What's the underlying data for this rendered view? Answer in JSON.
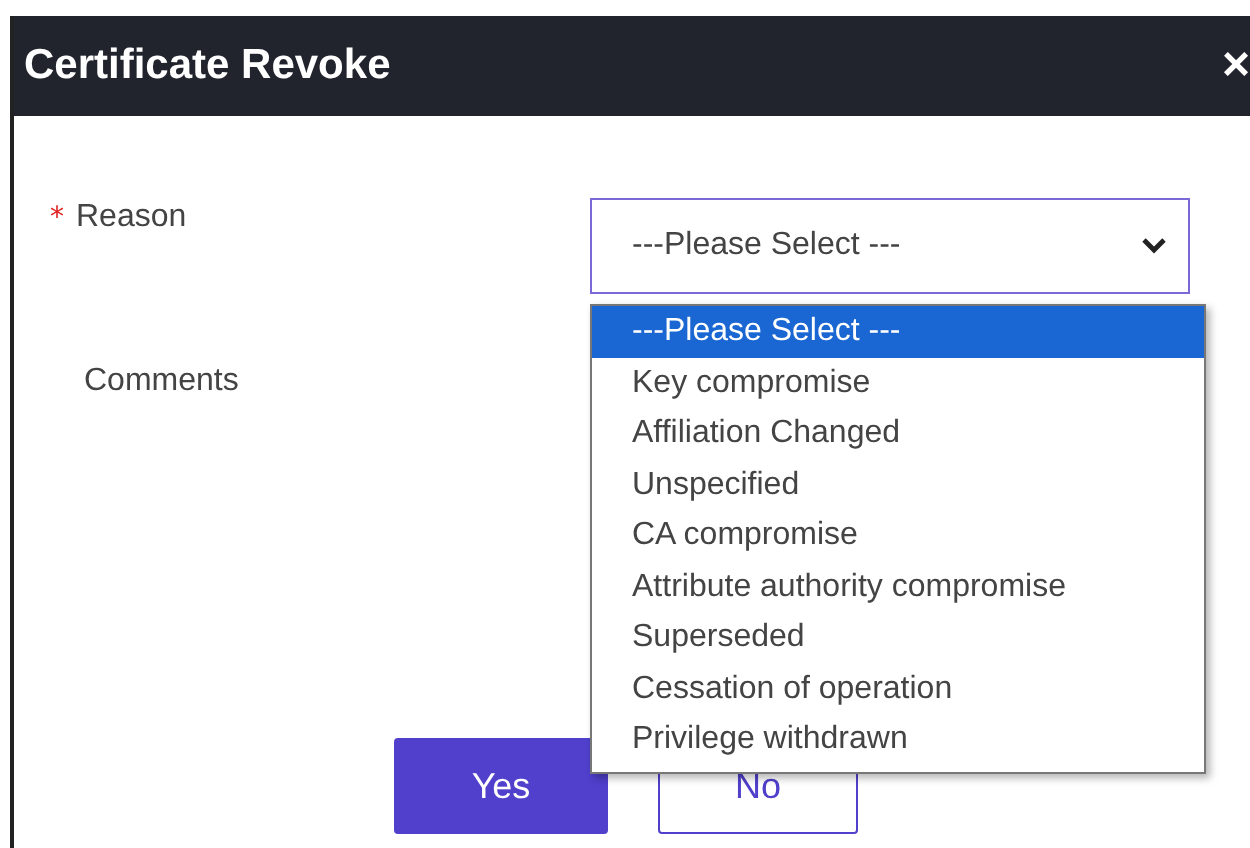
{
  "dialog": {
    "title": "Certificate Revoke",
    "close": "×"
  },
  "fields": [
    {
      "label": "Reason",
      "required": true,
      "required_mark": "*",
      "kind": "select",
      "value": "---Please Select ---"
    },
    {
      "label": "Comments",
      "required": false,
      "kind": "text"
    }
  ],
  "dropdown": {
    "options": [
      {
        "label": "---Please Select ---",
        "selected": true
      },
      {
        "label": "Key compromise",
        "selected": false
      },
      {
        "label": "Affiliation Changed",
        "selected": false
      },
      {
        "label": "Unspecified",
        "selected": false
      },
      {
        "label": "CA compromise",
        "selected": false
      },
      {
        "label": "Attribute authority compromise",
        "selected": false
      },
      {
        "label": "Superseded",
        "selected": false
      },
      {
        "label": "Cessation of operation",
        "selected": false
      },
      {
        "label": "Privilege withdrawn",
        "selected": false
      }
    ]
  },
  "buttons": [
    {
      "label": "Yes",
      "kind": "primary"
    },
    {
      "label": "No",
      "kind": "secondary"
    }
  ]
}
